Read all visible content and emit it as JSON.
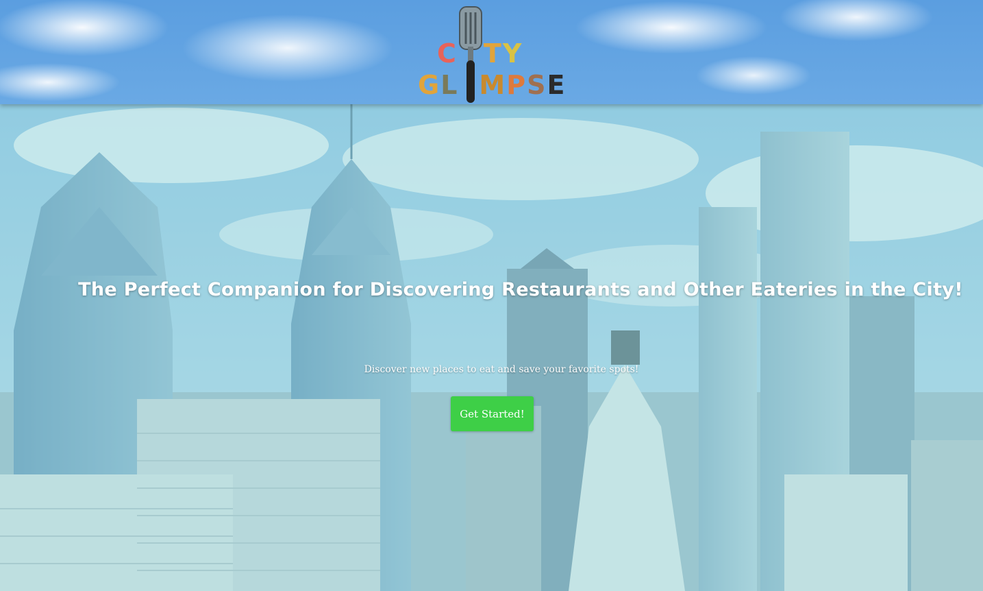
{
  "header": {
    "logo_alt": "City Glimpse",
    "logo_row1": [
      "C",
      "I",
      "T",
      "Y"
    ],
    "logo_row2": [
      "G",
      "L",
      "I",
      "M",
      "P",
      "S",
      "E"
    ]
  },
  "hero": {
    "title": "The Perfect Companion for Discovering Restaurants and Other Eateries in the City!",
    "subtitle": "Discover new places to eat and save your favorite spots!",
    "cta_label": "Get Started!"
  },
  "colors": {
    "cta": "#3ecf47",
    "overlay": "#96d7d7",
    "header_sky": "#5b9ee0"
  }
}
